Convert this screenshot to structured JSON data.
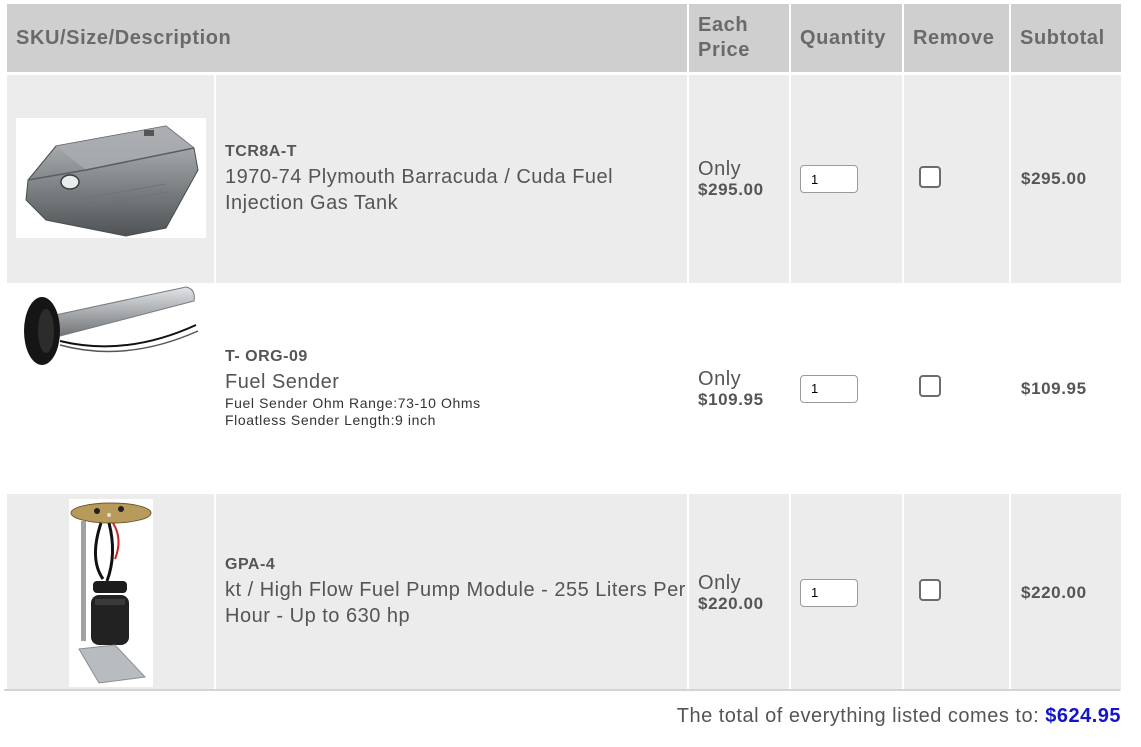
{
  "headers": {
    "sku": "SKU/Size/Description",
    "price_line1": "Each",
    "price_line2": "Price",
    "quantity": "Quantity",
    "remove": "Remove",
    "subtotal": "Subtotal"
  },
  "items": [
    {
      "image": "fuel-tank-image",
      "sku": "TCR8A-T",
      "title": "1970-74 Plymouth Barracuda / Cuda Fuel Injection Gas Tank",
      "attributes": [],
      "only": "Only",
      "price": "$295.00",
      "quantity": "1",
      "remove_checked": false,
      "subtotal": "$295.00"
    },
    {
      "image": "fuel-sender-image",
      "sku": "T- ORG-09",
      "title": "Fuel Sender",
      "attributes": [
        "Fuel Sender Ohm Range:73-10 Ohms",
        "Floatless Sender Length:9 inch"
      ],
      "only": "Only",
      "price": "$109.95",
      "quantity": "1",
      "remove_checked": false,
      "subtotal": "$109.95"
    },
    {
      "image": "fuel-pump-module-image",
      "sku": "GPA-4",
      "title": "kt / High Flow Fuel Pump Module - 255 Liters Per Hour - Up to 630 hp",
      "attributes": [],
      "only": "Only",
      "price": "$220.00",
      "quantity": "1",
      "remove_checked": false,
      "subtotal": "$220.00"
    }
  ],
  "total": {
    "label": "The total of everything listed comes to:",
    "amount": "$624.95"
  },
  "colors": {
    "header_bg": "#cfcfcf",
    "row_alt_bg": "#ececec",
    "total_amount": "#1414c8"
  }
}
